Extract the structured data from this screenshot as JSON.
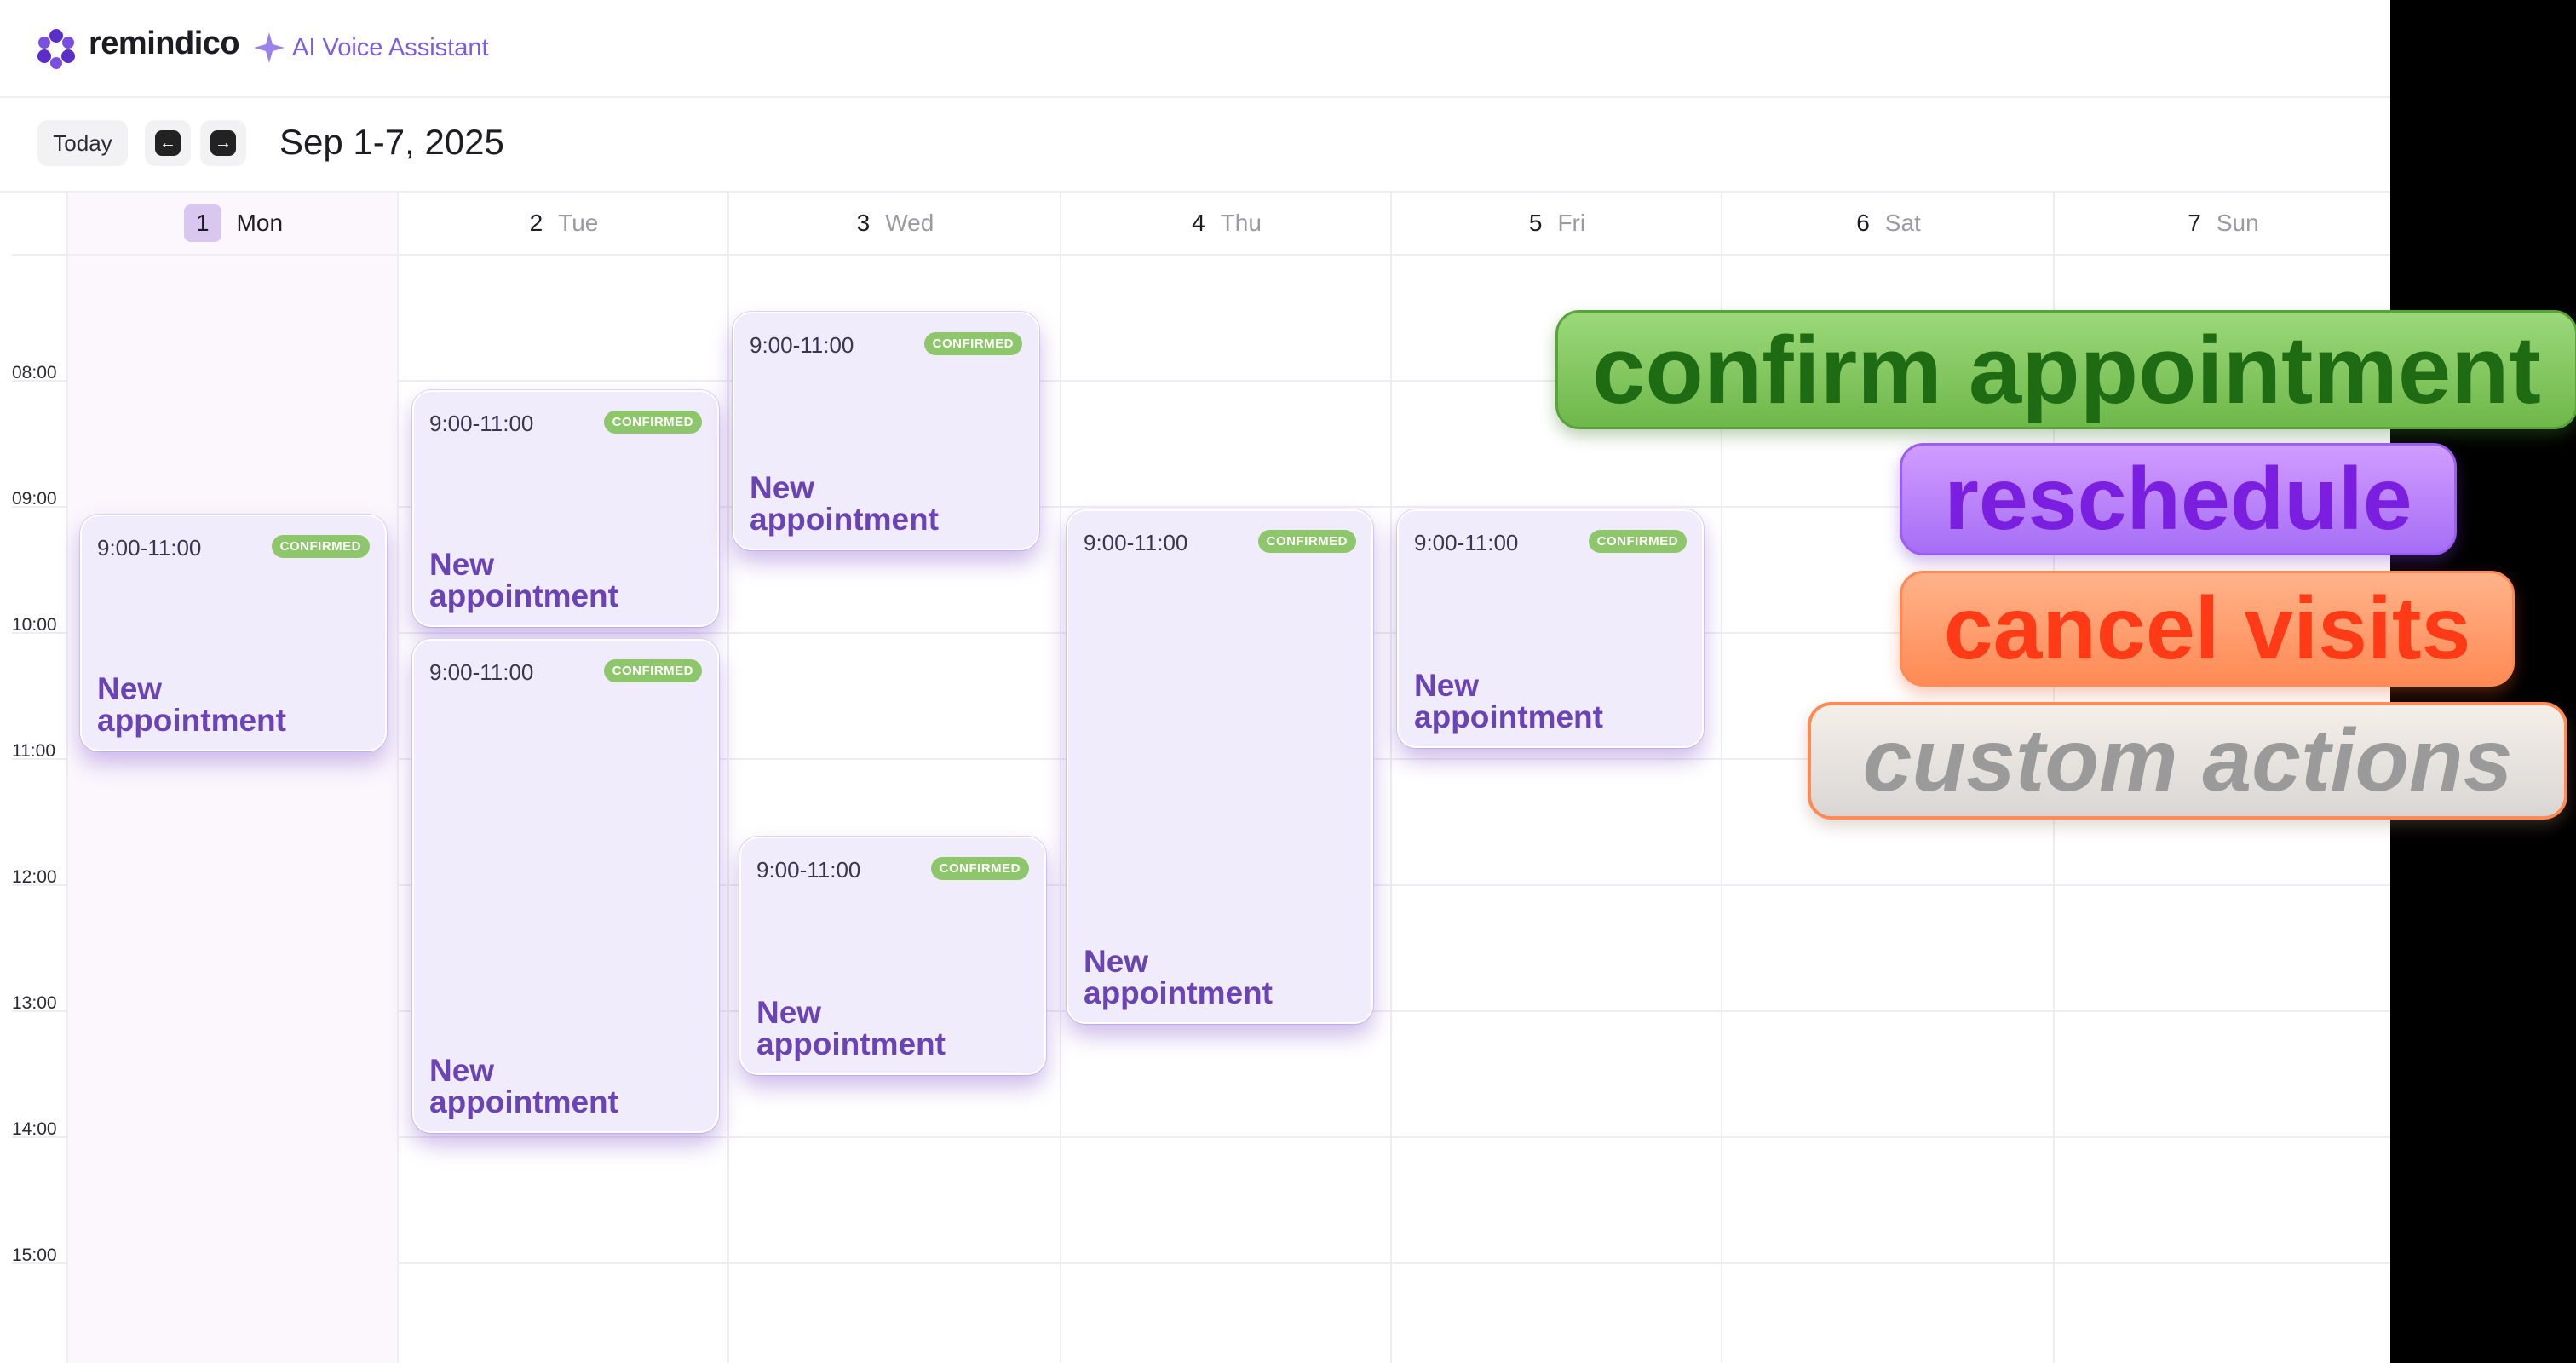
{
  "header": {
    "brand": "remindico",
    "assistant_label": "AI Voice Assistant"
  },
  "toolbar": {
    "today_label": "Today",
    "prev_icon": "arrow-left-icon",
    "next_icon": "arrow-right-icon",
    "date_range": "Sep 1-7, 2025"
  },
  "days": [
    {
      "num": "1",
      "name": "Mon",
      "today": true
    },
    {
      "num": "2",
      "name": "Tue"
    },
    {
      "num": "3",
      "name": "Wed"
    },
    {
      "num": "4",
      "name": "Thu"
    },
    {
      "num": "5",
      "name": "Fri"
    },
    {
      "num": "6",
      "name": "Sat"
    },
    {
      "num": "7",
      "name": "Sun"
    }
  ],
  "hours": [
    "08:00",
    "09:00",
    "10:00",
    "11:00",
    "12:00",
    "13:00",
    "14:00",
    "15:00"
  ],
  "appointments": [
    {
      "day": "Mon",
      "time": "9:00-11:00",
      "status": "CONFIRMED",
      "title": "New appointment"
    },
    {
      "day": "Tue",
      "time": "9:00-11:00",
      "status": "CONFIRMED",
      "title": "New appointment"
    },
    {
      "day": "Tue",
      "time": "9:00-11:00",
      "status": "CONFIRMED",
      "title": "New appointment"
    },
    {
      "day": "Wed",
      "time": "9:00-11:00",
      "status": "CONFIRMED",
      "title": "New appointment"
    },
    {
      "day": "Wed",
      "time": "9:00-11:00",
      "status": "CONFIRMED",
      "title": "New appointment"
    },
    {
      "day": "Thu",
      "time": "9:00-11:00",
      "status": "CONFIRMED",
      "title": "New appointment"
    },
    {
      "day": "Fri",
      "time": "9:00-11:00",
      "status": "CONFIRMED",
      "title": "New appointment"
    }
  ],
  "actions": [
    "confirm appointment",
    "reschedule",
    "cancel visits",
    "custom actions"
  ],
  "colors": {
    "brand_purple": "#7c5ce4",
    "appointment_bg": "#f1ecfb",
    "appointment_title": "#6a43b4",
    "confirmed_badge": "#8dc66b",
    "today_highlight": "#d9c7f0",
    "action_green": "#6fb84a",
    "action_purple": "#a66ef5",
    "action_orange": "#ff8a55",
    "action_grey": "#d9d6d4"
  }
}
